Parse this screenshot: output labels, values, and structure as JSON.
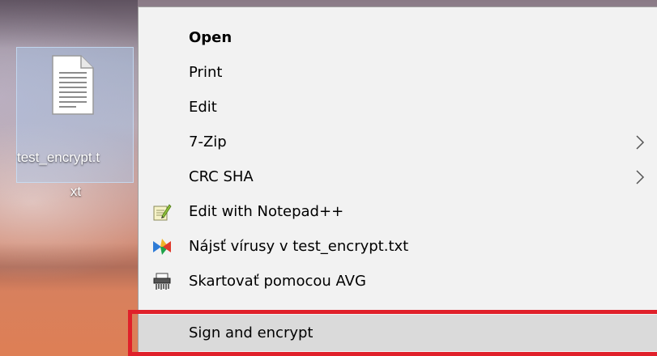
{
  "desktop": {
    "file": {
      "name_line1": "test_encrypt.t",
      "name_line2": "xt",
      "icon": "text-file-icon"
    }
  },
  "context_menu": {
    "items": [
      {
        "label": "Open",
        "bold": true,
        "icon": null,
        "has_submenu": false
      },
      {
        "label": "Print",
        "bold": false,
        "icon": null,
        "has_submenu": false
      },
      {
        "label": "Edit",
        "bold": false,
        "icon": null,
        "has_submenu": false
      },
      {
        "label": "7-Zip",
        "bold": false,
        "icon": null,
        "has_submenu": true
      },
      {
        "label": "CRC SHA",
        "bold": false,
        "icon": null,
        "has_submenu": true
      },
      {
        "label": "Edit with Notepad++",
        "bold": false,
        "icon": "notepadpp-icon",
        "has_submenu": false
      },
      {
        "label": "Nájsť vírusy v test_encrypt.txt",
        "bold": false,
        "icon": "avg-icon",
        "has_submenu": false
      },
      {
        "label": "Skartovať pomocou AVG",
        "bold": false,
        "icon": "shredder-icon",
        "has_submenu": false
      },
      {
        "label": "Sign and encrypt",
        "bold": false,
        "icon": null,
        "has_submenu": false,
        "highlighted": true
      }
    ]
  },
  "colors": {
    "menu_background": "#f2f2f2",
    "highlight_background": "#dadada",
    "annotation_border": "#e0202a",
    "selection_fill": "#aac8eb"
  }
}
